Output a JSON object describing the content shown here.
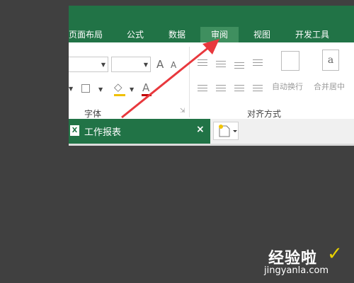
{
  "ribbon": {
    "tabs": [
      {
        "label": "页面布局"
      },
      {
        "label": "公式"
      },
      {
        "label": "数据"
      },
      {
        "label": "审阅",
        "active": true
      },
      {
        "label": "视图"
      },
      {
        "label": "开发工具"
      }
    ],
    "groups": {
      "font": {
        "label": "字体",
        "font_name": "",
        "font_size": ""
      },
      "alignment": {
        "label": "对齐方式",
        "wrap_text": "自动换行",
        "merge_center": "合并居中"
      }
    },
    "glyphs": {
      "grow_font": "A",
      "shrink_font": "A",
      "font_color": "A",
      "wrap_icon": "a"
    }
  },
  "sheet_tabs": {
    "active_title": "工作报表",
    "close_symbol": "×",
    "excel_icon_letter": "X"
  },
  "annotation": {
    "arrow_color": "#e8383d"
  },
  "watermark": {
    "site_name": "经验啦",
    "check_mark": "✓",
    "url": "jingyanla.com"
  },
  "colors": {
    "ribbon_green": "#217346",
    "active_tab": "#3f8f5f",
    "background": "#404040"
  }
}
